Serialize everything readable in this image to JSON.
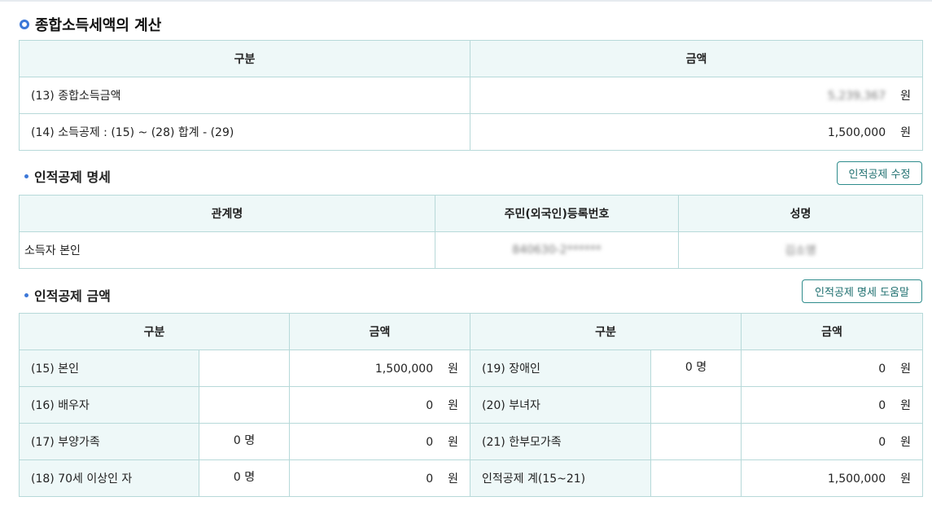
{
  "section": {
    "title": "종합소득세액의 계산"
  },
  "calc_table": {
    "headers": [
      "구분",
      "금액"
    ],
    "rows": [
      {
        "label": "(13) 종합소득금액",
        "value": "5,239,367",
        "unit": "원"
      },
      {
        "label": "(14) 소득공제 : (15) ~ (28) 합계 - (29)",
        "value": "1,500,000",
        "unit": "원"
      }
    ]
  },
  "personal_details": {
    "title": "인적공제 명세",
    "edit_button": "인적공제 수정",
    "headers": [
      "관계명",
      "주민(외국인)등록번호",
      "성명"
    ],
    "row": {
      "relation": "소득자 본인",
      "id_number": "840630-2******",
      "name": "김소영"
    }
  },
  "personal_amount": {
    "title": "인적공제 금액",
    "help_button": "인적공제 명세 도움말",
    "headers": [
      "구분",
      "금액",
      "구분",
      "금액"
    ],
    "rows": [
      {
        "left_label": "(15) 본인",
        "left_count": "",
        "left_amount": "1,500,000",
        "right_label": "(19) 장애인",
        "right_count": "0 명",
        "right_amount": "0"
      },
      {
        "left_label": "(16) 배우자",
        "left_count": "",
        "left_amount": "0",
        "right_label": "(20) 부녀자",
        "right_count": "",
        "right_amount": "0"
      },
      {
        "left_label": "(17) 부양가족",
        "left_count": "0 명",
        "left_amount": "0",
        "right_label": "(21) 한부모가족",
        "right_count": "",
        "right_amount": "0"
      },
      {
        "left_label": "(18) 70세 이상인 자",
        "left_count": "0 명",
        "left_amount": "0",
        "right_label": "인적공제 계(15~21)",
        "right_count": "",
        "right_amount": "1,500,000"
      }
    ],
    "unit": "원"
  },
  "colors": {
    "accent": "#3c78d8",
    "border": "#b7d9d9",
    "header_bg": "#eef8f8",
    "button_border": "#2e8c8c"
  }
}
